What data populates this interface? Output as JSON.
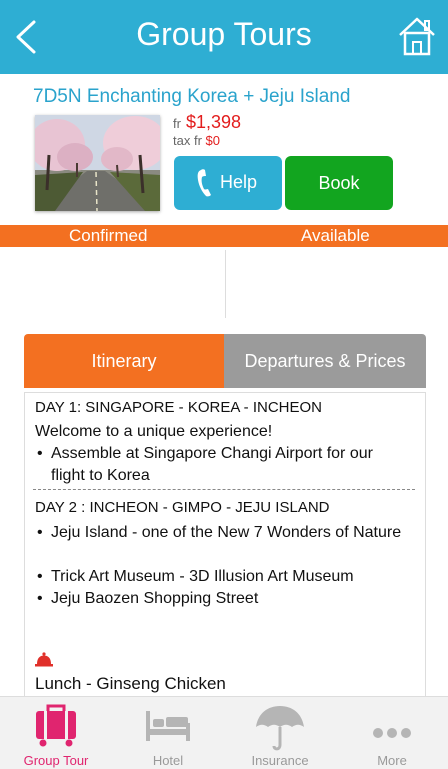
{
  "header": {
    "title": "Group Tours",
    "back_icon": "chevron-left-icon",
    "home_icon": "home-icon",
    "color": "#2eaed3"
  },
  "tour": {
    "title": "7D5N Enchanting Korea + Jeju Island",
    "price_prefix": "fr",
    "price": "$1,398",
    "tax_label": "tax fr",
    "tax_value": "$0"
  },
  "actions": {
    "help_label": "Help",
    "book_label": "Book"
  },
  "status": {
    "confirmed": "Confirmed",
    "available": "Available",
    "color": "#f37021"
  },
  "tabs": [
    {
      "label": "Itinerary",
      "active": true
    },
    {
      "label": "Departures & Prices",
      "active": false
    }
  ],
  "itinerary": {
    "day1": {
      "heading": "DAY 1: SINGAPORE - KOREA - INCHEON",
      "intro": "Welcome to a unique experience!",
      "bullets": [
        "Assemble at Singapore Changi Airport for our flight to Korea"
      ]
    },
    "day2": {
      "heading": "DAY 2 : INCHEON - GIMPO - JEJU ISLAND",
      "bullets": [
        "Jeju Island - one of the New 7 Wonders of Nature",
        "Trick Art Museum - 3D Illusion Art Museum",
        "Jeju Baozen Shopping Street"
      ],
      "meal_icon": "meal-bell-icon",
      "meal": "Lunch - Ginseng Chicken"
    }
  },
  "bottom_nav": [
    {
      "label": "Group Tour",
      "icon": "luggage-icon",
      "active": true
    },
    {
      "label": "Hotel",
      "icon": "bed-icon",
      "active": false
    },
    {
      "label": "Insurance",
      "icon": "umbrella-icon",
      "active": false
    },
    {
      "label": "More",
      "icon": "more-dots-icon",
      "active": false
    }
  ]
}
